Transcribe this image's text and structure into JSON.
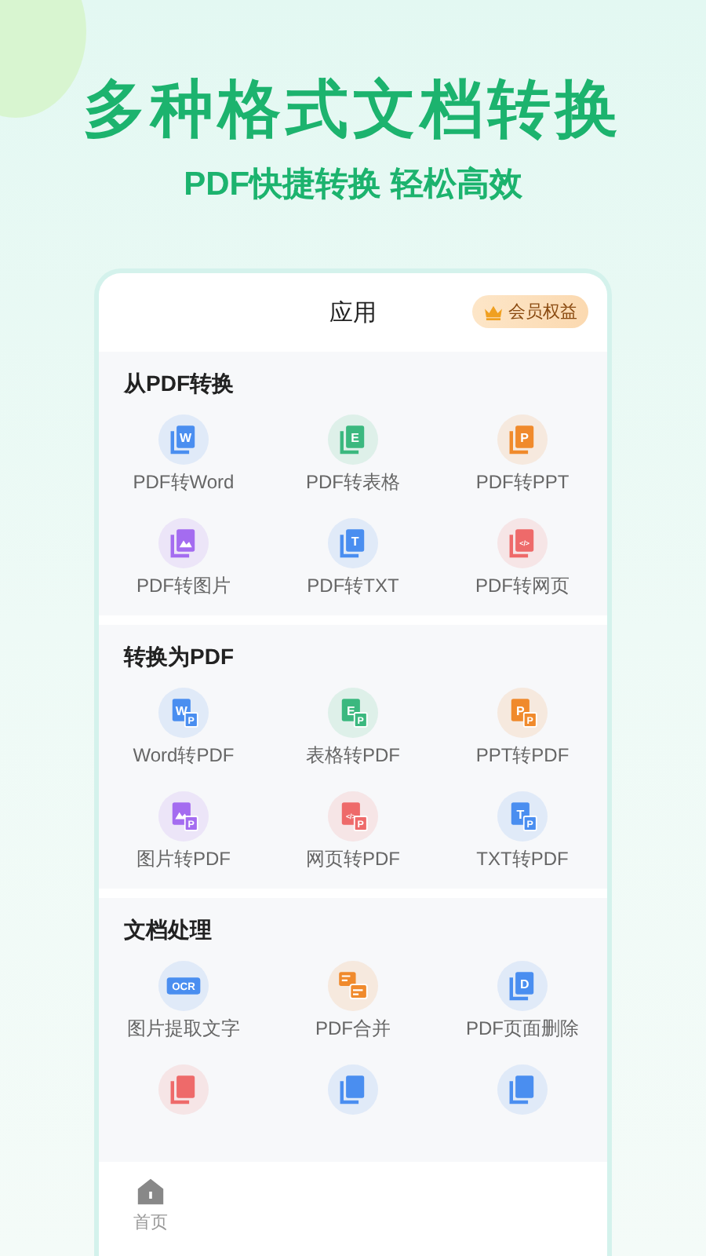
{
  "headline": "多种格式文档转换",
  "tagline": "PDF快捷转换 轻松高效",
  "panel": {
    "title": "应用",
    "member_badge": "会员权益",
    "sections": [
      {
        "title": "从PDF转换",
        "items": [
          {
            "label": "PDF转Word",
            "icon": {
              "kind": "stack",
              "glyph": "W",
              "color": "#4a8ef0"
            }
          },
          {
            "label": "PDF转表格",
            "icon": {
              "kind": "stack",
              "glyph": "E",
              "color": "#3bb87f"
            }
          },
          {
            "label": "PDF转PPT",
            "icon": {
              "kind": "stack",
              "glyph": "P",
              "color": "#f08a2c"
            }
          },
          {
            "label": "PDF转图片",
            "icon": {
              "kind": "stack",
              "image": true,
              "color": "#a46cf0"
            }
          },
          {
            "label": "PDF转TXT",
            "icon": {
              "kind": "stack",
              "glyph": "T",
              "color": "#4a8ef0"
            }
          },
          {
            "label": "PDF转网页",
            "icon": {
              "kind": "stack",
              "glyph": "</>",
              "color": "#ee6a6a"
            }
          }
        ]
      },
      {
        "title": "转换为PDF",
        "items": [
          {
            "label": "Word转PDF",
            "icon": {
              "kind": "badge",
              "glyph": "W",
              "badge": "P",
              "color": "#4a8ef0"
            }
          },
          {
            "label": "表格转PDF",
            "icon": {
              "kind": "badge",
              "glyph": "E",
              "badge": "P",
              "color": "#3bb87f"
            }
          },
          {
            "label": "PPT转PDF",
            "icon": {
              "kind": "badge",
              "glyph": "P",
              "badge": "P",
              "color": "#f08a2c"
            }
          },
          {
            "label": "图片转PDF",
            "icon": {
              "kind": "badge",
              "image": true,
              "badge": "P",
              "color": "#a46cf0"
            }
          },
          {
            "label": "网页转PDF",
            "icon": {
              "kind": "badge",
              "glyph": "</>",
              "badge": "P",
              "color": "#ee6a6a"
            }
          },
          {
            "label": "TXT转PDF",
            "icon": {
              "kind": "badge",
              "glyph": "T",
              "badge": "P",
              "color": "#4a8ef0"
            }
          }
        ]
      },
      {
        "title": "文档处理",
        "items": [
          {
            "label": "图片提取文字",
            "icon": {
              "kind": "ocr",
              "glyph": "OCR",
              "color": "#4a8ef0"
            }
          },
          {
            "label": "PDF合并",
            "icon": {
              "kind": "merge",
              "color": "#f08a2c"
            }
          },
          {
            "label": "PDF页面删除",
            "icon": {
              "kind": "stack",
              "glyph": "D",
              "color": "#4a8ef0"
            }
          },
          {
            "icon": {
              "kind": "stack",
              "color": "#ee6a6a"
            }
          },
          {
            "icon": {
              "kind": "stack",
              "color": "#4a8ef0"
            }
          },
          {
            "icon": {
              "kind": "stack",
              "color": "#4a8ef0"
            }
          }
        ]
      }
    ]
  },
  "bottom_nav": [
    {
      "label": "首页"
    }
  ]
}
